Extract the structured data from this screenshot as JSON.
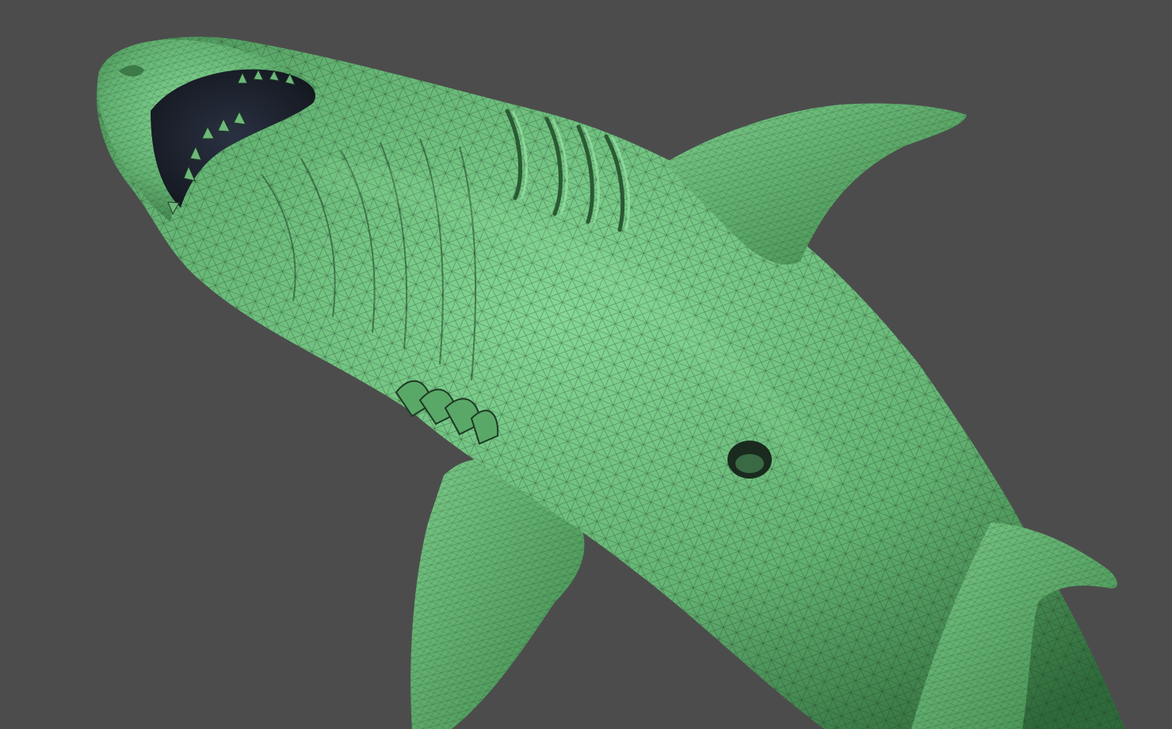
{
  "viewport": {
    "background_color": "#4c4c4c"
  },
  "model": {
    "subject": "shark",
    "render_style": "green matcap with dark wireframe overlay",
    "colors": {
      "skin_light": "#7fd08f",
      "skin_mid": "#5fb06e",
      "skin_dark": "#2f6a3a",
      "wireframe": "#1e3a24",
      "mouth_interior": "#1c2230",
      "shadow": "#141414"
    }
  }
}
